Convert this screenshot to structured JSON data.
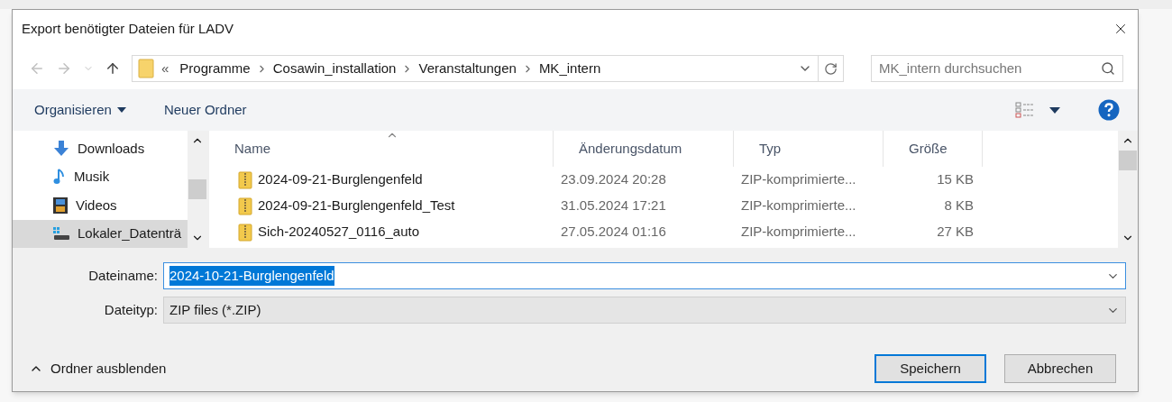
{
  "window": {
    "title": "Export benötigter Dateien für LADV"
  },
  "address": {
    "overflow": "«",
    "path": [
      "Programme",
      "Cosawin_installation",
      "Veranstaltungen",
      "MK_intern"
    ]
  },
  "search": {
    "placeholder": "MK_intern durchsuchen"
  },
  "toolbar": {
    "organize": "Organisieren",
    "new_folder": "Neuer Ordner"
  },
  "sidebar": {
    "items": [
      {
        "label": "Downloads",
        "kind": "downloads",
        "selected": false
      },
      {
        "label": "Musik",
        "kind": "music",
        "selected": false
      },
      {
        "label": "Videos",
        "kind": "videos",
        "selected": false
      },
      {
        "label": "Lokaler_Datenträ",
        "kind": "drive",
        "selected": true
      }
    ]
  },
  "table": {
    "columns": [
      {
        "label": "Name",
        "sorted": true
      },
      {
        "label": "Änderungsdatum",
        "sorted": false
      },
      {
        "label": "Typ",
        "sorted": false
      },
      {
        "label": "Größe",
        "sorted": false
      }
    ],
    "rows": [
      {
        "name": "2024-09-21-Burglengenfeld",
        "date": "23.09.2024 20:28",
        "type": "ZIP-komprimierte...",
        "size": "15 KB"
      },
      {
        "name": "2024-09-21-Burglengenfeld_Test",
        "date": "31.05.2024 17:21",
        "type": "ZIP-komprimierte...",
        "size": "8 KB"
      },
      {
        "name": "Sich-20240527_0116_auto",
        "date": "27.05.2024 01:16",
        "type": "ZIP-komprimierte...",
        "size": "27 KB"
      }
    ]
  },
  "form": {
    "filename": {
      "label": "Dateiname:",
      "value": "2024-10-21-Burglengenfeld"
    },
    "filetype": {
      "label": "Dateityp:",
      "value": "ZIP files (*.ZIP)"
    }
  },
  "footer": {
    "hide_folders": "Ordner ausblenden",
    "buttons": [
      {
        "label": "Speichern",
        "default": true
      },
      {
        "label": "Abbrechen",
        "default": false
      }
    ]
  }
}
